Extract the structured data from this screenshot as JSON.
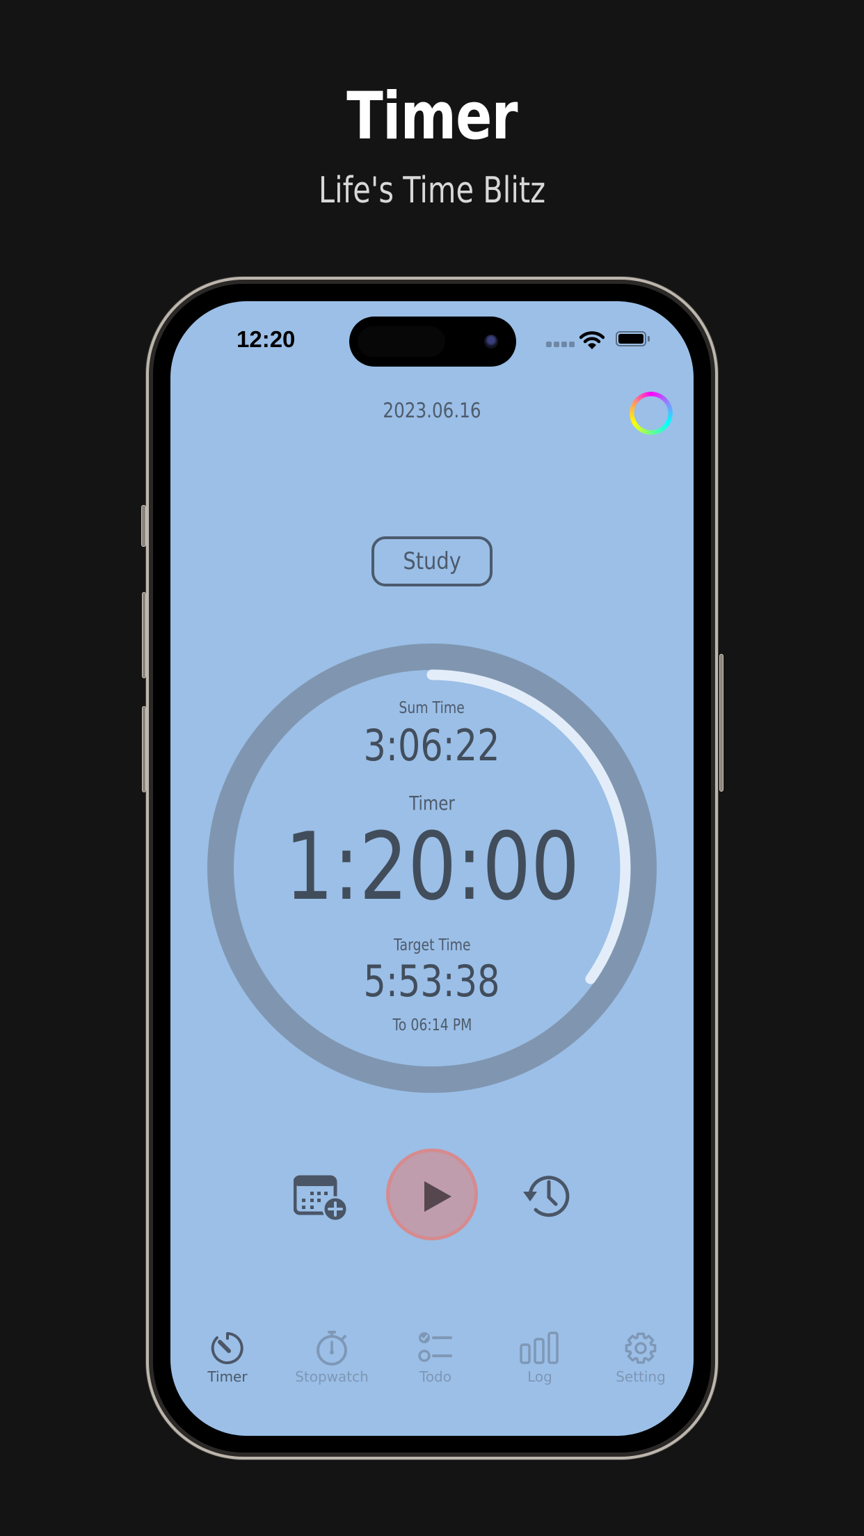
{
  "promo": {
    "title": "Timer",
    "subtitle": "Life's Time Blitz"
  },
  "status_bar": {
    "time": "12:20",
    "icons": [
      "cellular-signal-icon",
      "wifi-icon",
      "battery-icon"
    ]
  },
  "header": {
    "date": "2023.06.16",
    "theme_icon": "color-wheel-icon"
  },
  "tag": {
    "label": "Study"
  },
  "timer": {
    "sum_label": "Sum Time",
    "sum_value": "3:06:22",
    "timer_label": "Timer",
    "timer_value": "1:20:00",
    "target_label": "Target Time",
    "target_value": "5:53:38",
    "target_until": "To 06:14 PM",
    "progress": 0.347
  },
  "controls": {
    "left_icon": "calendar-add-icon",
    "center_icon": "play-icon",
    "right_icon": "history-icon"
  },
  "tabbar": {
    "items": [
      {
        "label": "Timer",
        "icon": "timer-icon",
        "active": true
      },
      {
        "label": "Stopwatch",
        "icon": "stopwatch-icon",
        "active": false
      },
      {
        "label": "Todo",
        "icon": "checklist-icon",
        "active": false
      },
      {
        "label": "Log",
        "icon": "bar-chart-icon",
        "active": false
      },
      {
        "label": "Setting",
        "icon": "gear-icon",
        "active": false
      }
    ]
  },
  "colors": {
    "screen_bg": "#9bbfe7",
    "ring_track": "#8096b0",
    "ring_progress": "#e3edf9",
    "text_dark": "#424d5b",
    "play_fill": "#bf9dad",
    "play_border": "#d68b8f",
    "tab_inactive": "#7f97b5"
  }
}
